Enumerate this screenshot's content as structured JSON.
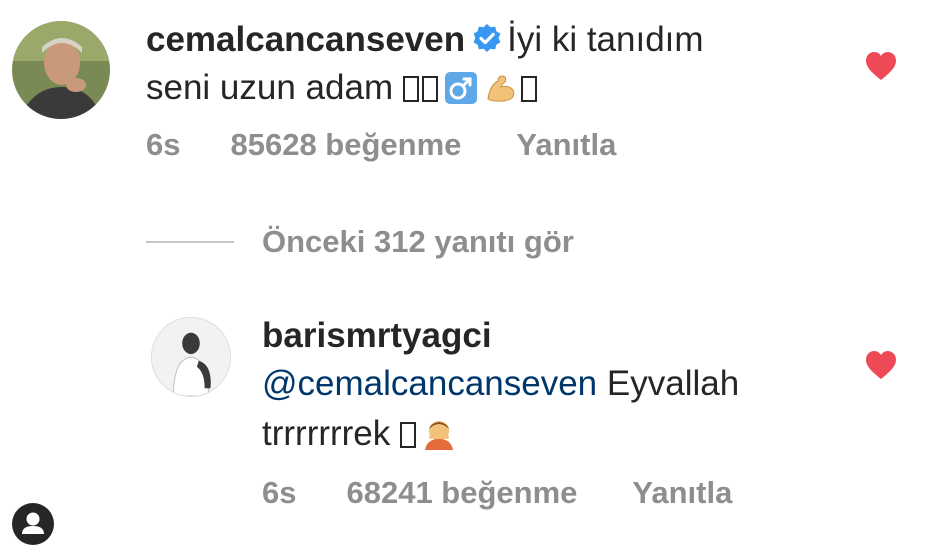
{
  "colors": {
    "heart": "#ed4956",
    "verified": "#3897f0",
    "meta_text": "#8e8e8e",
    "mention": "#00376b",
    "text": "#262626"
  },
  "comments": [
    {
      "username": "cemalcancanseven",
      "verified": true,
      "text_line_1": "İyi ki tanıdım",
      "text_line_2": "seni uzun adam",
      "emoji": [
        "box-glyph",
        "male-sign-emoji",
        "flexed-biceps-emoji",
        "box-glyph"
      ],
      "time": "6s",
      "likes": "85628 beğenme",
      "reply_label": "Yanıtla",
      "liked": true
    },
    {
      "username": "barismrtyagci",
      "verified": false,
      "mention": "@cemalcancanseven",
      "text_line_2_rest": " Eyvallah",
      "text_line_3": "trrrrrrrek",
      "emoji": [
        "box-glyph",
        "person-emoji"
      ],
      "time": "6s",
      "likes": "68241 beğenme",
      "reply_label": "Yanıtla",
      "liked": true
    }
  ],
  "view_replies": {
    "label": "Önceki 312 yanıtı gör"
  },
  "icons": {
    "heart": "heart-icon",
    "verified": "verified-badge-icon",
    "profile": "profile-icon"
  }
}
